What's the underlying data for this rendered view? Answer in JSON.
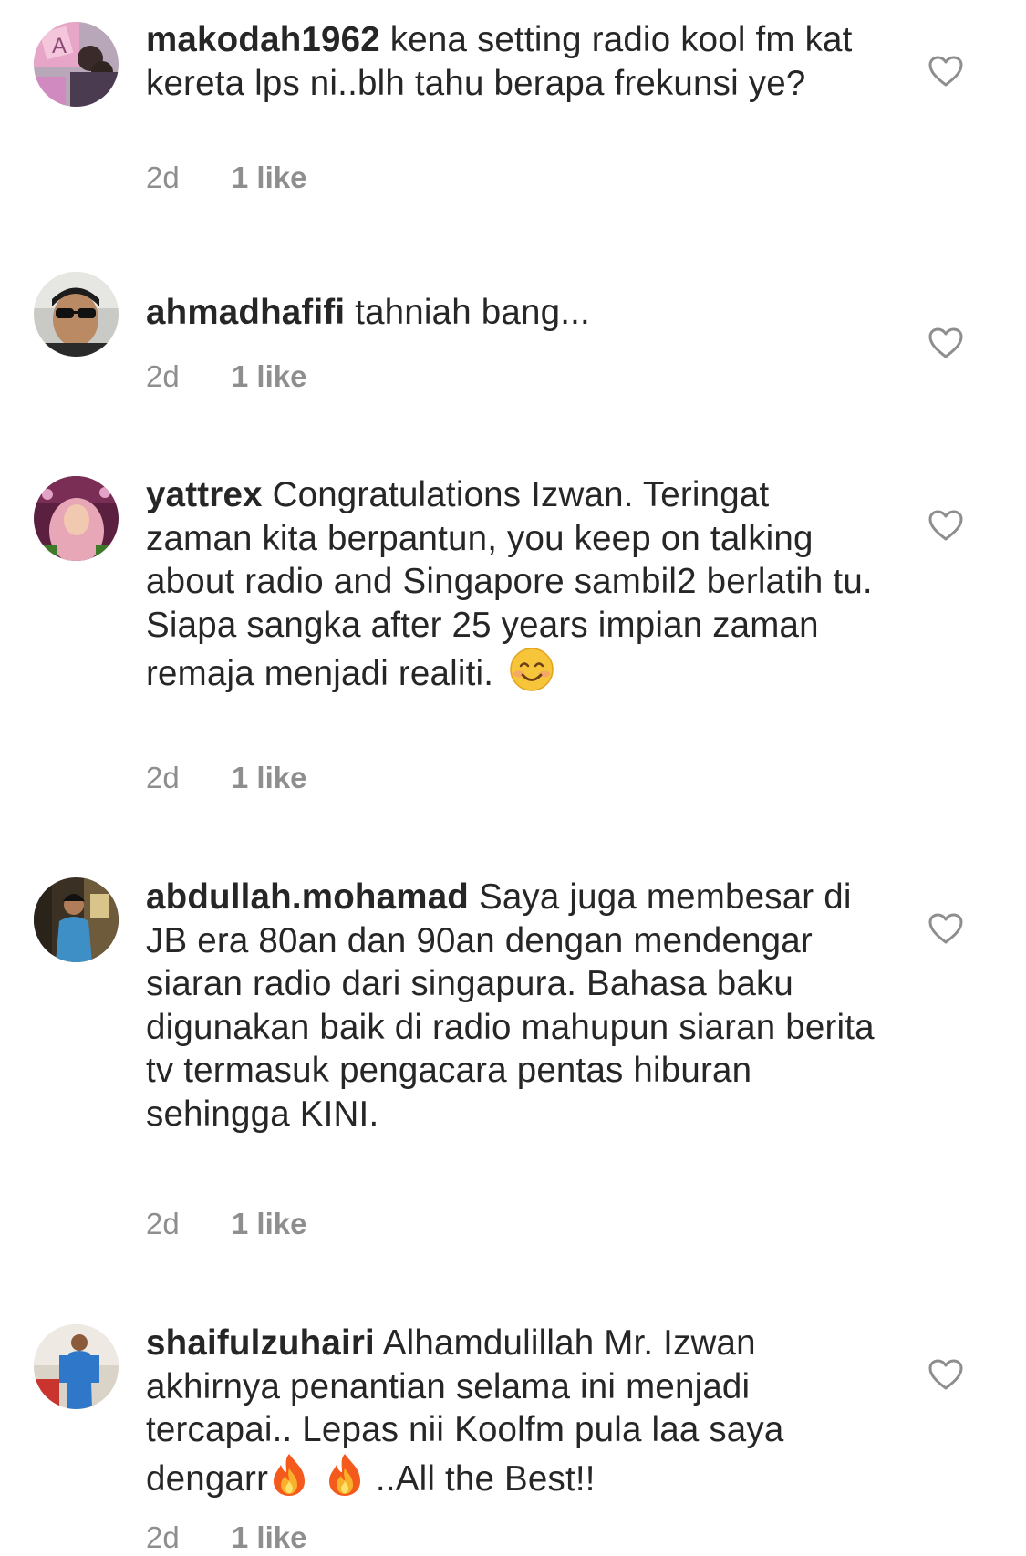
{
  "comments": [
    {
      "username": "makodah1962",
      "text": "kena setting radio kool fm kat kereta lps ni..blh tahu berapa frekunsi ye?",
      "time": "2d",
      "likes": "1 like",
      "avatar": "avatar-makodah1962"
    },
    {
      "username": "ahmadhafifi",
      "text": "tahniah bang...",
      "time": "2d",
      "likes": "1 like",
      "avatar": "avatar-ahmadhafifi"
    },
    {
      "username": "yattrex",
      "text": "Congratulations Izwan. Teringat zaman kita berpantun, you keep on talking about radio and Singapore sambil2 berlatih tu. Siapa sangka after 25 years impian zaman remaja menjadi realiti.",
      "emoji": "smiling-face-emoji",
      "time": "2d",
      "likes": "1 like",
      "avatar": "avatar-yattrex"
    },
    {
      "username": "abdullah.mohamad",
      "text": "Saya juga membesar di JB era 80an dan 90an dengan mendengar siaran radio dari singapura. Bahasa baku digunakan baik di radio mahupun siaran berita tv termasuk pengacara pentas hiburan sehingga KINI.",
      "time": "2d",
      "likes": "1 like",
      "avatar": "avatar-abdullah-mohamad"
    },
    {
      "username": "shaifulzuhairi",
      "text_a": "Alhamdulillah Mr. Izwan akhirnya penantian selama ini menjadi tercapai.. Lepas nii Koolfm pula laa saya dengarr",
      "text_b": "..All the Best!!",
      "emoji": "fire-emoji",
      "time": "2d",
      "likes": "1 like",
      "avatar": "avatar-shaifulzuhairi"
    }
  ],
  "icons": {
    "like": "heart-outline-icon"
  },
  "colors": {
    "text": "#262626",
    "meta": "#8e8e8e",
    "heart_stroke": "#8e8e8e"
  }
}
